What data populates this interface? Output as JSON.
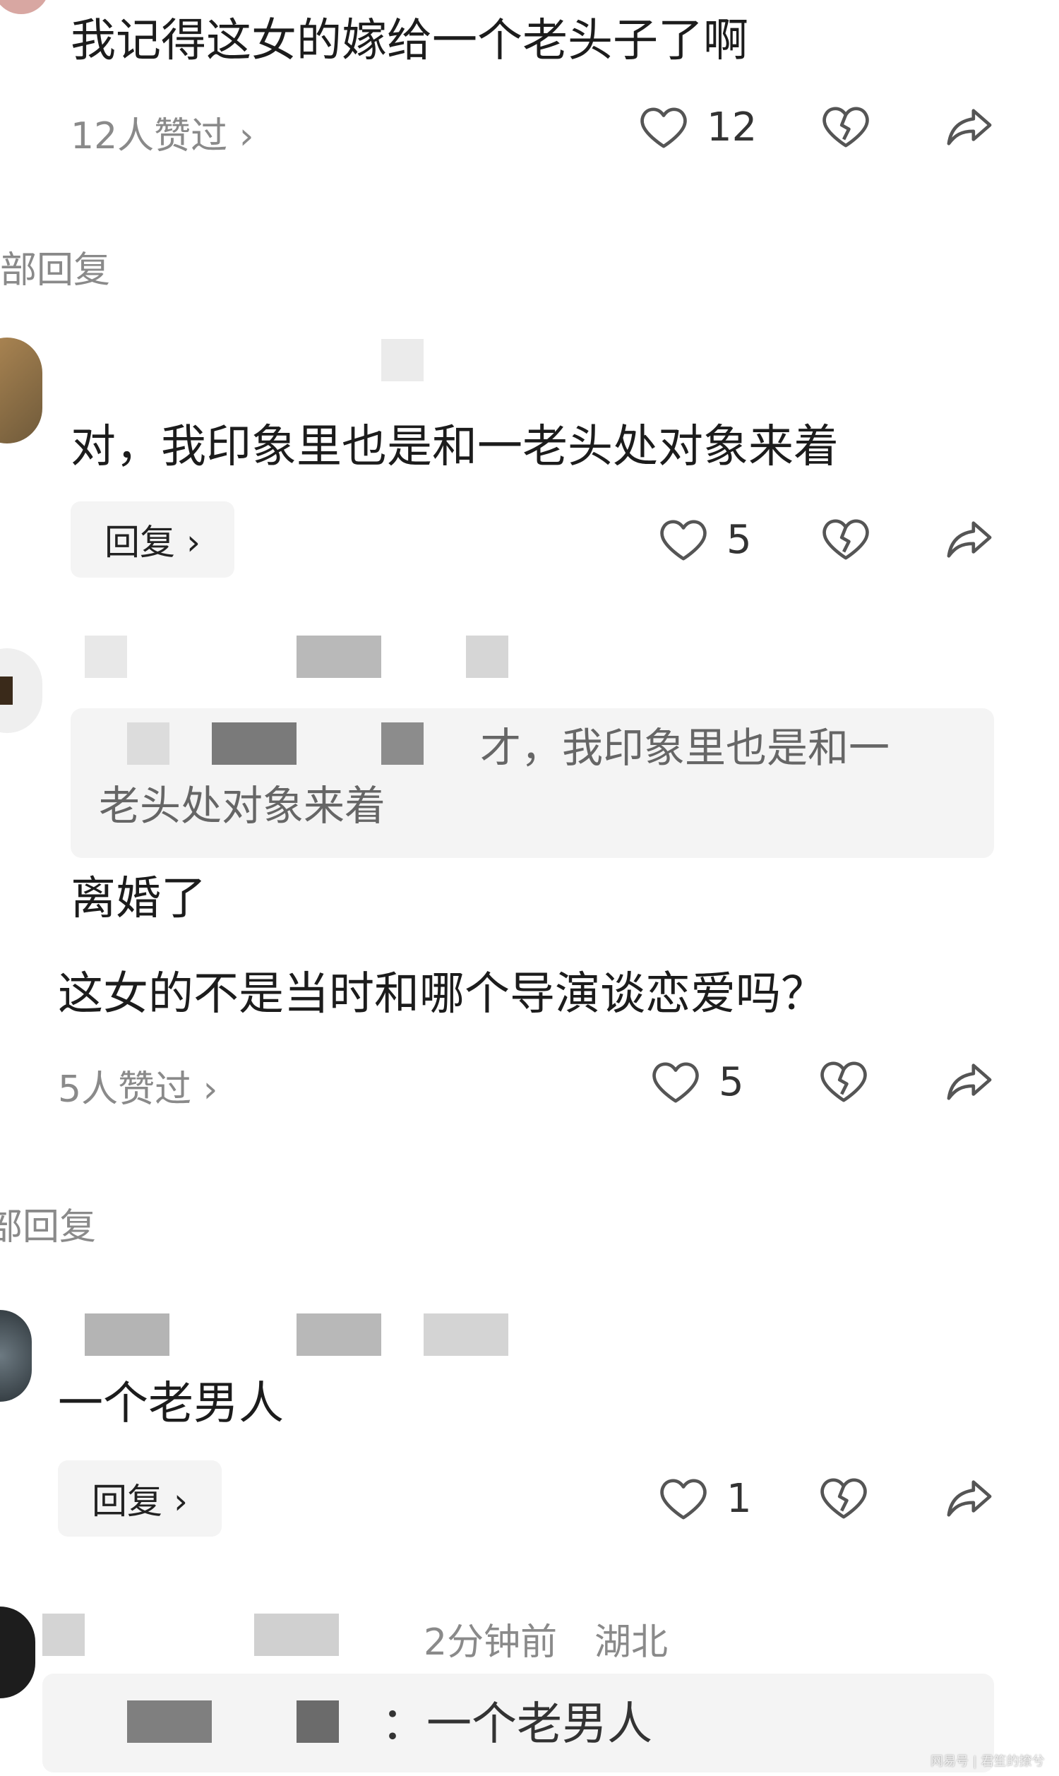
{
  "comments": {
    "c1": {
      "text": "我记得这女的嫁给一个老头子了啊",
      "likes_link": "12人赞过 ›",
      "like_count": "12"
    },
    "all_replies_1": "部回复",
    "c2": {
      "text": "对，我印象里也是和一老头处对象来着",
      "reply_label": "回复 ›",
      "like_count": "5"
    },
    "c3": {
      "quote_line1": "才，我印象里也是和一",
      "quote_line2": "老头处对象来着",
      "text": "离婚了"
    },
    "c4": {
      "text": "这女的不是当时和哪个导演谈恋爱吗？",
      "likes_link": "5人赞过 ›",
      "like_count": "5"
    },
    "all_replies_2": "部回复",
    "c5": {
      "text": "一个老男人",
      "reply_label": "回复 ›",
      "like_count": "1"
    },
    "c6": {
      "time": "2分钟前",
      "location": "湖北",
      "quote": "：一个老男人"
    }
  },
  "watermark": "网易号 | 君笙的撩兮",
  "icons": [
    "heart-icon",
    "broken-heart-icon",
    "share-icon"
  ],
  "colors": {
    "text": "#1c1c1c",
    "meta": "#8a8a8a",
    "bubble": "#f4f4f4",
    "icon": "#555555"
  }
}
